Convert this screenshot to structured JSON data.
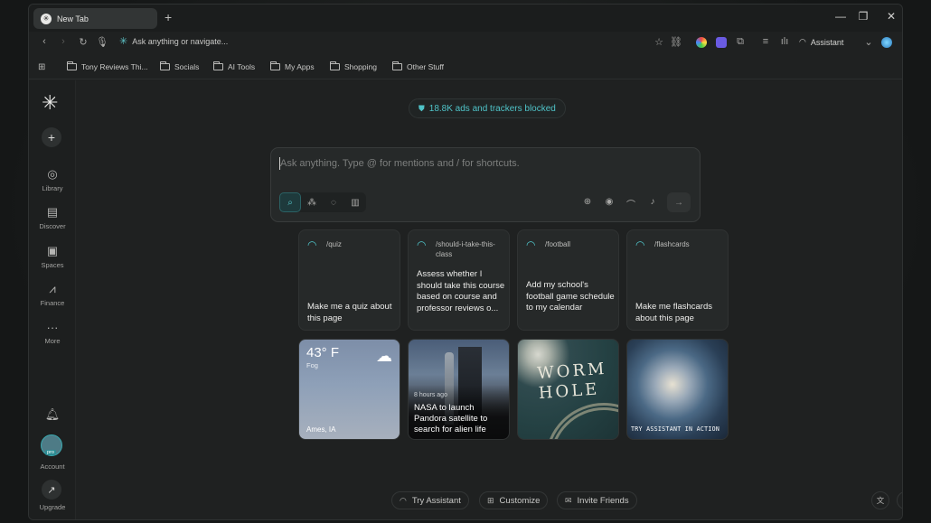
{
  "browser": {
    "tab_title": "New Tab",
    "new_tab_label": "+",
    "omnibox_placeholder": "Ask anything or navigate...",
    "assistant_label": "Assistant",
    "window_controls": [
      "—",
      "❐",
      "✕"
    ]
  },
  "bookmarks": [
    {
      "label": "Tony Reviews Thi..."
    },
    {
      "label": "Socials"
    },
    {
      "label": "AI Tools"
    },
    {
      "label": "My Apps"
    },
    {
      "label": "Shopping"
    },
    {
      "label": "Other Stuff"
    }
  ],
  "sidebar": {
    "items": [
      {
        "label": "Library",
        "icon": "library-icon"
      },
      {
        "label": "Discover",
        "icon": "discover-icon"
      },
      {
        "label": "Spaces",
        "icon": "spaces-icon"
      },
      {
        "label": "Finance",
        "icon": "finance-icon"
      },
      {
        "label": "More",
        "icon": "more-icon"
      }
    ],
    "account_label": "Account",
    "pro_badge": "pro",
    "upgrade_label": "Upgrade"
  },
  "main": {
    "ads_blocked": "18.8K ads and trackers blocked",
    "search_placeholder": "Ask anything. Type @ for mentions and / for shortcuts.",
    "shortcut_cards": [
      {
        "command": "/quiz",
        "description": "Make me a quiz about this page"
      },
      {
        "command": "/should-i-take-this-class",
        "description": "Assess whether I should take this course based on course and professor reviews o..."
      },
      {
        "command": "/football",
        "description": "Add my school's football game schedule to my calendar"
      },
      {
        "command": "/flashcards",
        "description": "Make me flashcards about this page"
      }
    ],
    "weather": {
      "temp": "43° F",
      "condition": "Fog",
      "location": "Ames, IA"
    },
    "news": {
      "time": "8 hours ago",
      "headline": "NASA to launch Pandora satellite to search for alien life"
    },
    "wormhole_text": "WORM HOLE",
    "demo_caption": "TRY ASSISTANT IN ACTION",
    "bottom_actions": [
      {
        "label": "Try Assistant"
      },
      {
        "label": "Customize"
      },
      {
        "label": "Invite Friends"
      }
    ]
  },
  "colors": {
    "accent": "#4fc3c8",
    "background": "#1f2121"
  }
}
